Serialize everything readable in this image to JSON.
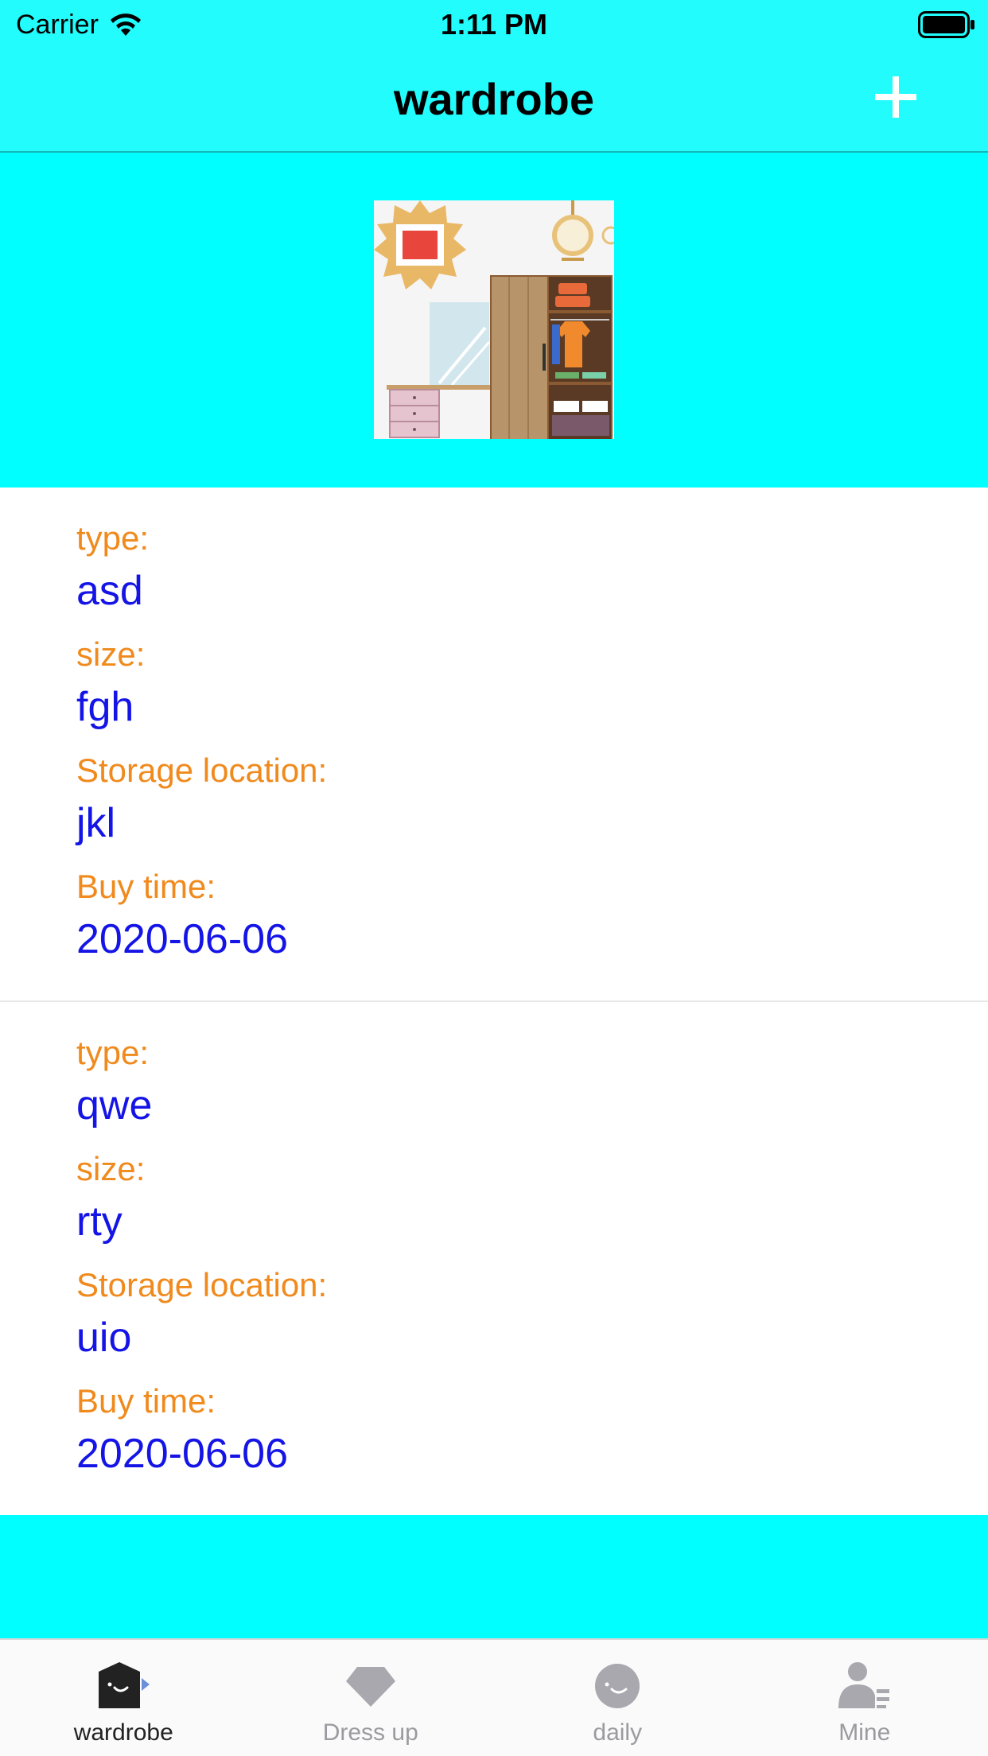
{
  "status_bar": {
    "carrier": "Carrier",
    "time": "1:11 PM"
  },
  "nav": {
    "title": "wardrobe",
    "add_icon": "plus-icon"
  },
  "header": {
    "image": "wardrobe-room-illustration"
  },
  "items": [
    {
      "type_label": "type:",
      "type_value": "asd",
      "size_label": "size:",
      "size_value": "fgh",
      "location_label": "Storage location:",
      "location_value": "jkl",
      "buy_label": "Buy time:",
      "buy_value": "2020-06-06"
    },
    {
      "type_label": "type:",
      "type_value": "qwe",
      "size_label": "size:",
      "size_value": "rty",
      "location_label": "Storage location:",
      "location_value": "uio",
      "buy_label": "Buy time:",
      "buy_value": "2020-06-06"
    }
  ],
  "tabs": [
    {
      "label": "wardrobe",
      "icon": "wardrobe-icon",
      "active": true
    },
    {
      "label": "Dress up",
      "icon": "diamond-icon",
      "active": false
    },
    {
      "label": "daily",
      "icon": "smile-icon",
      "active": false
    },
    {
      "label": "Mine",
      "icon": "person-icon",
      "active": false
    }
  ],
  "colors": {
    "accent": "#00ffff",
    "label": "#f08a1d",
    "value": "#1414e6"
  }
}
